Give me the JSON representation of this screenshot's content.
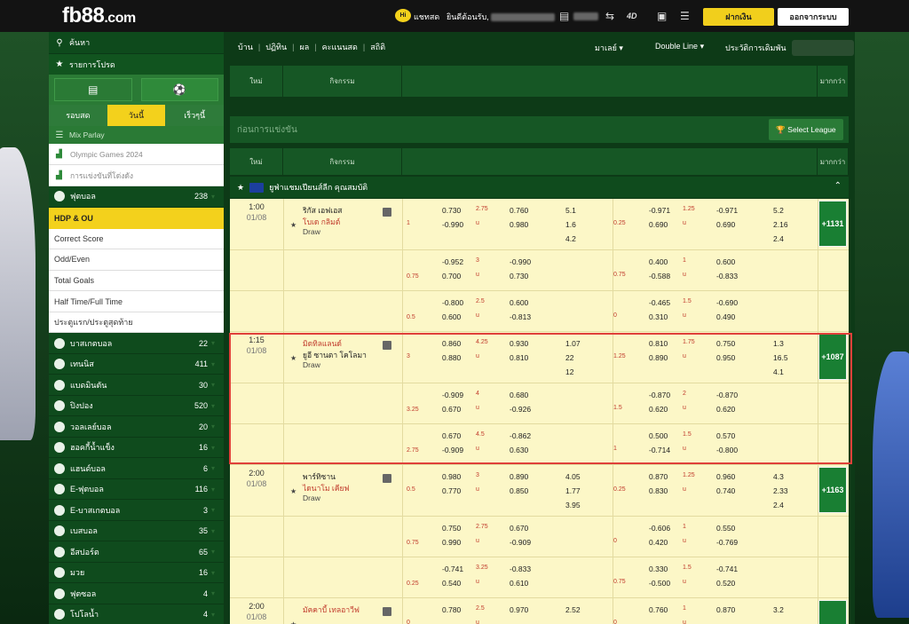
{
  "header": {
    "logo": "fb88",
    "logo_suffix": ".com",
    "hi_badge": "Hi",
    "chat": "แชทสด",
    "welcome": "ยินดีต้อนรับ,",
    "deposit": "ฝากเงิน",
    "logout": "ออกจากระบบ"
  },
  "sidebar": {
    "search": "ค้นหา",
    "favorites": "รายการโปรด",
    "tabs": [
      "รอบสด",
      "วันนี้",
      "เร็วๆนี้"
    ],
    "active_tab": 1,
    "mix_parlay": "Mix Parlay",
    "specials": [
      "Olympic Games 2024",
      "การแข่งขันที่โด่งดัง"
    ],
    "sports_top": [
      {
        "name": "ฟุตบอล",
        "count": "238"
      }
    ],
    "hdp": "HDP & OU",
    "submenu": [
      "Correct Score",
      "Odd/Even",
      "Total Goals",
      "Half Time/Full Time",
      "ประตูแรก/ประตูสุดท้าย"
    ],
    "sports": [
      {
        "name": "บาสเกตบอล",
        "count": "22"
      },
      {
        "name": "เทนนิส",
        "count": "411"
      },
      {
        "name": "แบดมินตัน",
        "count": "30"
      },
      {
        "name": "ปิงปอง",
        "count": "520"
      },
      {
        "name": "วอลเลย์บอล",
        "count": "20"
      },
      {
        "name": "ฮอคกี้น้ำแข็ง",
        "count": "16"
      },
      {
        "name": "แฮนด์บอล",
        "count": "6"
      },
      {
        "name": "E-ฟุตบอล",
        "count": "116"
      },
      {
        "name": "E-บาสเกตบอล",
        "count": "3"
      },
      {
        "name": "เบสบอล",
        "count": "35"
      },
      {
        "name": "อีสปอร์ต",
        "count": "65"
      },
      {
        "name": "มวย",
        "count": "16"
      },
      {
        "name": "ฟุตซอล",
        "count": "4"
      },
      {
        "name": "โปโลน้ำ",
        "count": "4"
      }
    ]
  },
  "nav": {
    "items": [
      "บ้าน",
      "ปฏิทิน",
      "ผล",
      "คะแนนสด",
      "สถิติ"
    ],
    "currency": "มาเลย์",
    "line": "Double Line",
    "history": "ประวัติการเดิมพัน"
  },
  "table": {
    "col_time": "ใหม่",
    "col_event": "กิจกรรม",
    "col_more": "มากกว่า",
    "section": "ก่อนการแข่งขัน",
    "select_league": "Select League",
    "league": "ยูฟ่าแชมเปียนส์ลีก คุณสมบัติ"
  },
  "matches": [
    {
      "time": "1:00",
      "date": "01/08",
      "home": "ริกัส เอฟเอส",
      "away": "โบเด กลิมต์",
      "draw": "Draw",
      "home_red": false,
      "away_red": true,
      "more": "+1131",
      "rows": [
        {
          "h1": "1",
          "hdp1_l": "",
          "ft_h": "0.730",
          "ft_a": "-0.990",
          "ou1": "2.75",
          "ou_h": "0.760",
          "ou_a": "0.980",
          "x1": "5.1",
          "x2": "1.6",
          "x3": "4.2",
          "h2": "0.25",
          "fh_h": "-0.971",
          "fh_a": "0.690",
          "ou2": "1.25",
          "fo_h": "-0.971",
          "fo_a": "0.690",
          "y1": "5.2",
          "y2": "2.16",
          "y3": "2.4"
        },
        {
          "h1": "0.75",
          "ft_h": "-0.952",
          "ft_a": "0.700",
          "ou1": "3",
          "ou_h": "-0.990",
          "ou_a": "0.730",
          "h2": "0.75",
          "fh_h": "0.400",
          "fh_a": "-0.588",
          "ou2": "1",
          "fo_h": "0.600",
          "fo_a": "-0.833"
        },
        {
          "h1": "0.5",
          "ft_h": "-0.800",
          "ft_a": "0.600",
          "ou1": "2.5",
          "ou_h": "0.600",
          "ou_a": "-0.813",
          "h2": "0",
          "fh_h": "-0.465",
          "fh_a": "0.310",
          "ou2": "1.5",
          "fo_h": "-0.690",
          "fo_a": "0.490"
        }
      ]
    },
    {
      "time": "1:15",
      "date": "01/08",
      "home": "มิดทิลแลนด์",
      "away": "ยูอี ซานตา โคโลมา",
      "draw": "Draw",
      "home_red": true,
      "away_red": false,
      "more": "+1087",
      "rows": [
        {
          "h1": "3",
          "ft_h": "0.860",
          "ft_a": "0.880",
          "ou1": "4.25",
          "ou_h": "0.930",
          "ou_a": "0.810",
          "x1": "1.07",
          "x2": "22",
          "x3": "12",
          "h2": "1.25",
          "fh_h": "0.810",
          "fh_a": "0.890",
          "ou2": "1.75",
          "fo_h": "0.750",
          "fo_a": "0.950",
          "y1": "1.3",
          "y2": "16.5",
          "y3": "4.1"
        },
        {
          "h1": "3.25",
          "ft_h": "-0.909",
          "ft_a": "0.670",
          "ou1": "4",
          "ou_h": "0.680",
          "ou_a": "-0.926",
          "h2": "1.5",
          "fh_h": "-0.870",
          "fh_a": "0.620",
          "ou2": "2",
          "fo_h": "-0.870",
          "fo_a": "0.620"
        },
        {
          "h1": "2.75",
          "ft_h": "0.670",
          "ft_a": "-0.909",
          "ou1": "4.5",
          "ou_h": "-0.862",
          "ou_a": "0.630",
          "h2": "1",
          "fh_h": "0.500",
          "fh_a": "-0.714",
          "ou2": "1.5",
          "fo_h": "0.570",
          "fo_a": "-0.800"
        }
      ]
    },
    {
      "time": "2:00",
      "date": "01/08",
      "home": "พาร์ทิซาน",
      "away": "ไดนาโม เคียฟ",
      "draw": "Draw",
      "home_red": false,
      "away_red": true,
      "more": "+1163",
      "rows": [
        {
          "h1": "0.5",
          "ft_h": "0.980",
          "ft_a": "0.770",
          "ou1": "3",
          "ou_h": "0.890",
          "ou_a": "0.850",
          "x1": "4.05",
          "x2": "1.77",
          "x3": "3.95",
          "h2": "0.25",
          "fh_h": "0.870",
          "fh_a": "0.830",
          "ou2": "1.25",
          "fo_h": "0.960",
          "fo_a": "0.740",
          "y1": "4.3",
          "y2": "2.33",
          "y3": "2.4"
        },
        {
          "h1": "0.75",
          "ft_h": "0.750",
          "ft_a": "0.990",
          "ou1": "2.75",
          "ou_h": "0.670",
          "ou_a": "-0.909",
          "h2": "0",
          "fh_h": "-0.606",
          "fh_a": "0.420",
          "ou2": "1",
          "fo_h": "0.550",
          "fo_a": "-0.769"
        },
        {
          "h1": "0.25",
          "ft_h": "-0.741",
          "ft_a": "0.540",
          "ou1": "3.25",
          "ou_h": "-0.833",
          "ou_a": "0.610",
          "h2": "0.75",
          "fh_h": "0.330",
          "fh_a": "-0.500",
          "ou2": "1.5",
          "fo_h": "-0.741",
          "fo_a": "0.520"
        }
      ]
    },
    {
      "time": "2:00",
      "date": "01/08",
      "home": "มัคคาบี้ เทลอาวีฟ",
      "away": "",
      "draw": "",
      "home_red": true,
      "away_red": false,
      "more": "",
      "rows": [
        {
          "h1": "0",
          "ft_h": "0.780",
          "ft_a": "",
          "ou1": "2.5",
          "ou_h": "0.970",
          "ou_a": "",
          "x1": "2.52",
          "x2": "",
          "x3": "",
          "h2": "0",
          "fh_h": "0.760",
          "fh_a": "",
          "ou2": "1",
          "fo_h": "0.870",
          "fo_a": "",
          "y1": "3.2",
          "y2": "",
          "y3": ""
        }
      ]
    }
  ]
}
